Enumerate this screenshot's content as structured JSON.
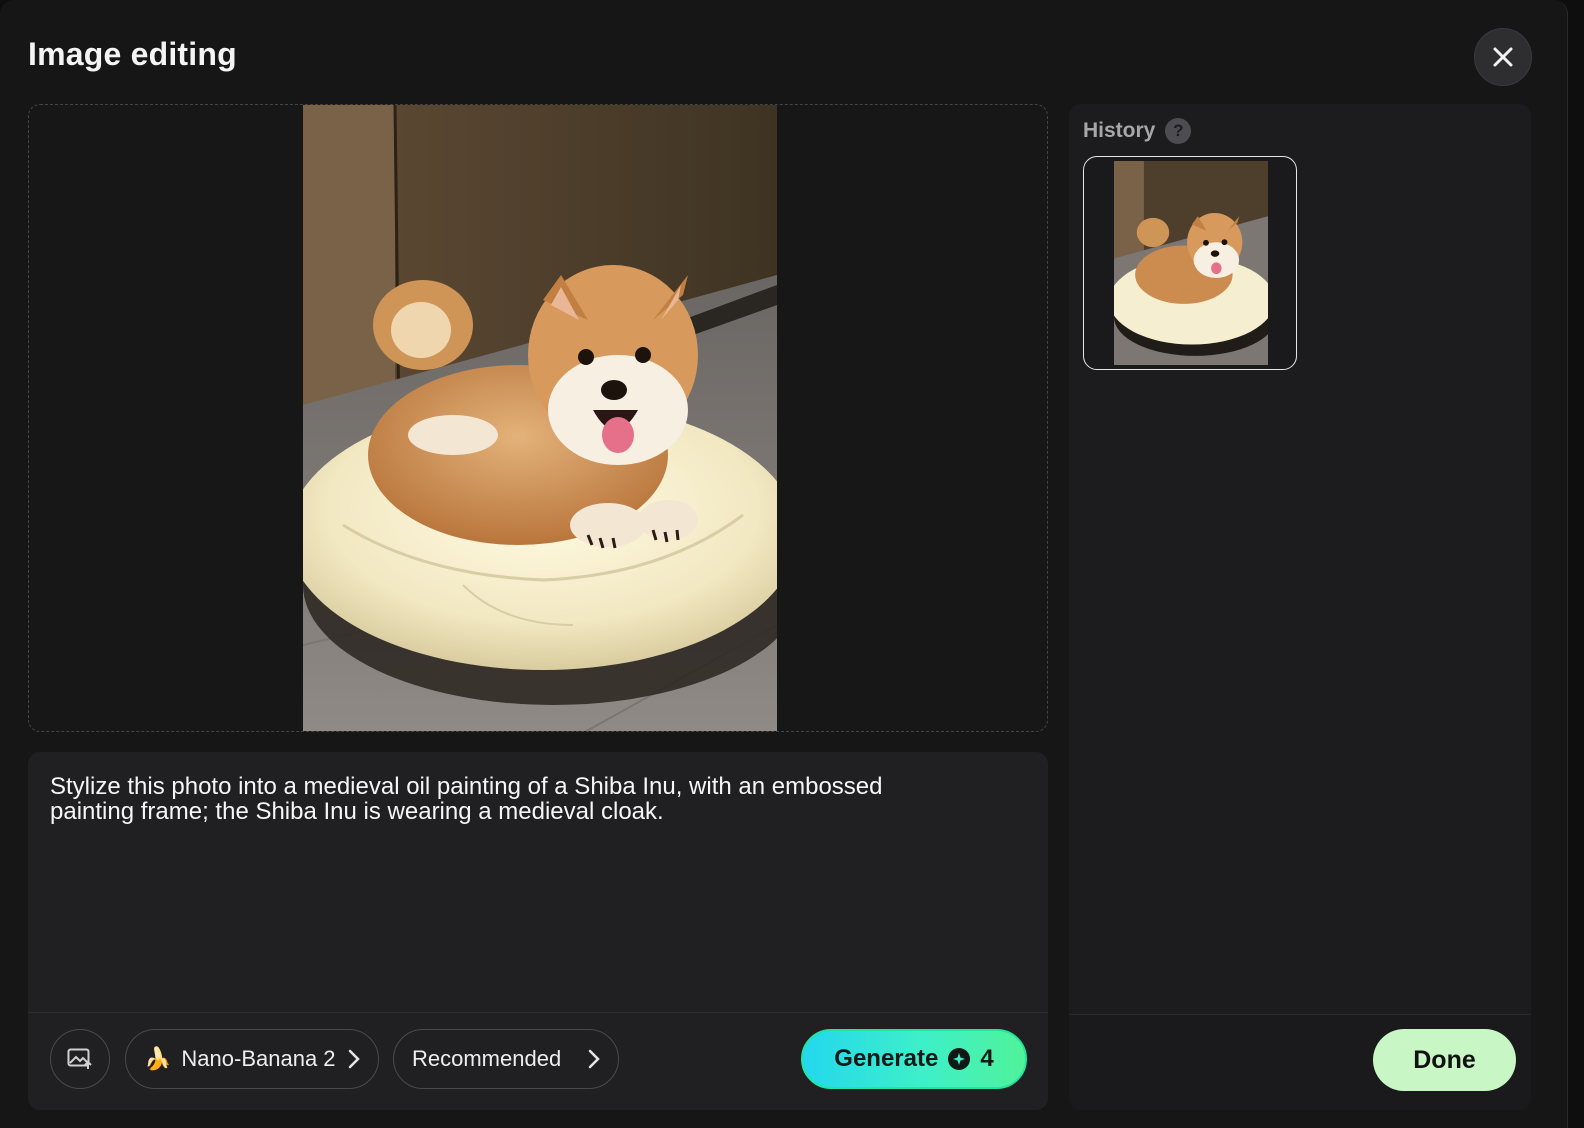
{
  "modal": {
    "title": "Image editing"
  },
  "prompt": {
    "text": "Stylize this photo into a medieval oil painting of a Shiba Inu, with an embossed\npainting frame; the Shiba Inu is wearing a medieval cloak."
  },
  "toolbar": {
    "upload_icon": "image-upload-icon",
    "model_emoji": "🍌",
    "model_label": "Nano-Banana 2",
    "style_label": "Recommended",
    "generate_label": "Generate",
    "generate_cost": "4"
  },
  "history": {
    "title": "History",
    "help_symbol": "?",
    "done_label": "Done"
  },
  "colors": {
    "accent_gradient_start": "#24d7ee",
    "accent_gradient_end": "#50f29a",
    "done_bg": "#c8f7c5"
  }
}
